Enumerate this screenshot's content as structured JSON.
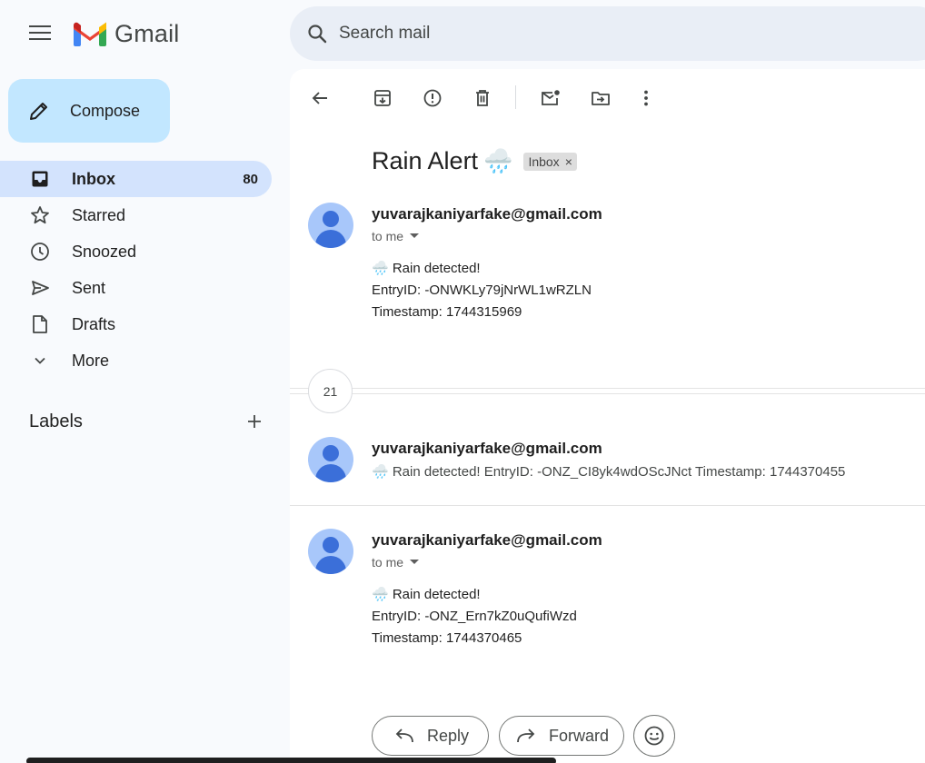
{
  "app": {
    "name": "Gmail"
  },
  "search": {
    "placeholder": "Search mail"
  },
  "compose": {
    "label": "Compose"
  },
  "nav": {
    "items": [
      {
        "label": "Inbox",
        "icon": "inbox-icon",
        "count": "80",
        "active": true
      },
      {
        "label": "Starred",
        "icon": "star-icon"
      },
      {
        "label": "Snoozed",
        "icon": "clock-icon"
      },
      {
        "label": "Sent",
        "icon": "send-icon"
      },
      {
        "label": "Drafts",
        "icon": "draft-icon"
      },
      {
        "label": "More",
        "icon": "chevron-down-icon"
      }
    ]
  },
  "labels": {
    "title": "Labels"
  },
  "thread": {
    "subject": "Rain Alert",
    "subject_emoji": "🌧️",
    "chip": "Inbox",
    "collapsed_count": "21",
    "messages": [
      {
        "sender": "yuvarajkaniyarfake@gmail.com",
        "to": "to me",
        "line1": "🌧️ Rain detected!",
        "line2": "EntryID: -ONWKLy79jNrWL1wRZLN",
        "line3": "Timestamp: 1744315969"
      },
      {
        "sender": "yuvarajkaniyarfake@gmail.com",
        "snippet": "🌧️ Rain detected! EntryID: -ONZ_CI8yk4wdOScJNct Timestamp: 1744370455"
      },
      {
        "sender": "yuvarajkaniyarfake@gmail.com",
        "to": "to me",
        "line1": "🌧️ Rain detected!",
        "line2": "EntryID: -ONZ_Ern7kZ0uQufiWzd",
        "line3": "Timestamp: 1744370465"
      }
    ]
  },
  "actions": {
    "reply": "Reply",
    "forward": "Forward"
  },
  "colors": {
    "accent": "#c2e7ff",
    "active_nav": "#d3e3fd",
    "search_bg": "#e9eef6"
  }
}
